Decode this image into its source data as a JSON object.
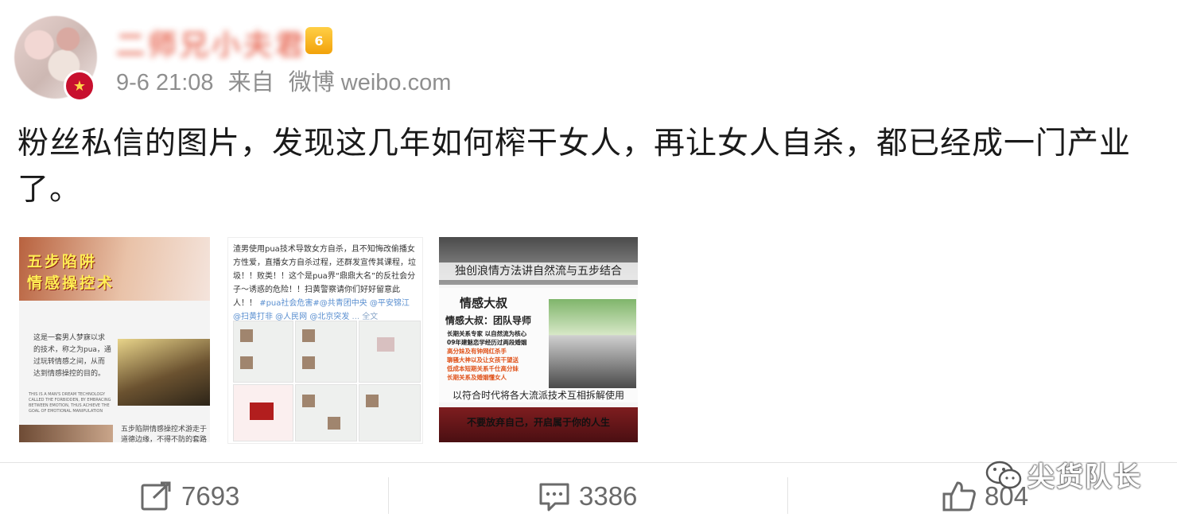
{
  "post": {
    "author_name": "二师兄小夫君",
    "vip_level": "6",
    "timestamp": "9-6 21:08",
    "source_prefix": "来自",
    "source_app": "微博 weibo.com",
    "text": "粉丝私信的图片，发现这几年如何榨干女人，再让女人自杀，都已经成一门产业了。"
  },
  "images": {
    "image1": {
      "title_line1": "五步陷阱",
      "title_line2": "情感操控术",
      "text1": "这是一套男人梦寐以求的技术，称之为pua，通过玩转情感之间，从而达到情感操控的目的。",
      "text_english": "THIS IS A MAN'S DREAM TECHNOLOGY CALLED THE FORBIDDEN, BY EMBRACING BETWEEN EMOTION, THUS ACHIEVE THE GOAL OF EMOTIONAL MANIPULATION",
      "text2": "五步陷阱情感操控术游走于道德边缘，不得不防的套路"
    },
    "image2": {
      "text_main": "渣男使用pua技术导致女方自杀，且不知悔改偷播女方性爱，直播女方自杀过程，还群发宣传其课程，垃圾！！败类！！这个是pua界“鼎鼎大名”的反社会分子～诱惑的危险！！扫黄警察请你们好好留意此人！！",
      "text_tags": "#pua社会危害#@共青团中央 @平安锦江 @扫黄打非 @人民网 @北京突发",
      "text_more": "... 全文"
    },
    "image3": {
      "caption_top": "独创浪情方法讲自然流与五步结合",
      "heading": "情感大叔",
      "subheading": "情感大叔：团队导师",
      "list": [
        "长期关系专家 以自然流为核心",
        "09年建魅恋学经历过两段婚姻",
        "高分妹及有钟网红杀手",
        "聊骚大神以及让女孩干望送",
        "低成本短期关系千仕高分妹",
        "长期关系及婚姻懂女人"
      ],
      "caption_mid": "以符合时代将各大流派技术互相拆解使用",
      "banner": "不要放弃自己，开启属于你的人生"
    }
  },
  "actions": {
    "repost_count": "7693",
    "comment_count": "3386",
    "like_count": "804"
  },
  "watermark": {
    "text": "尖货队长"
  },
  "colors": {
    "meta_gray": "#8f8f8f",
    "action_gray": "#6a6a6a",
    "vip_gold": "#f2a20a",
    "link_blue": "#5a8fd0"
  }
}
